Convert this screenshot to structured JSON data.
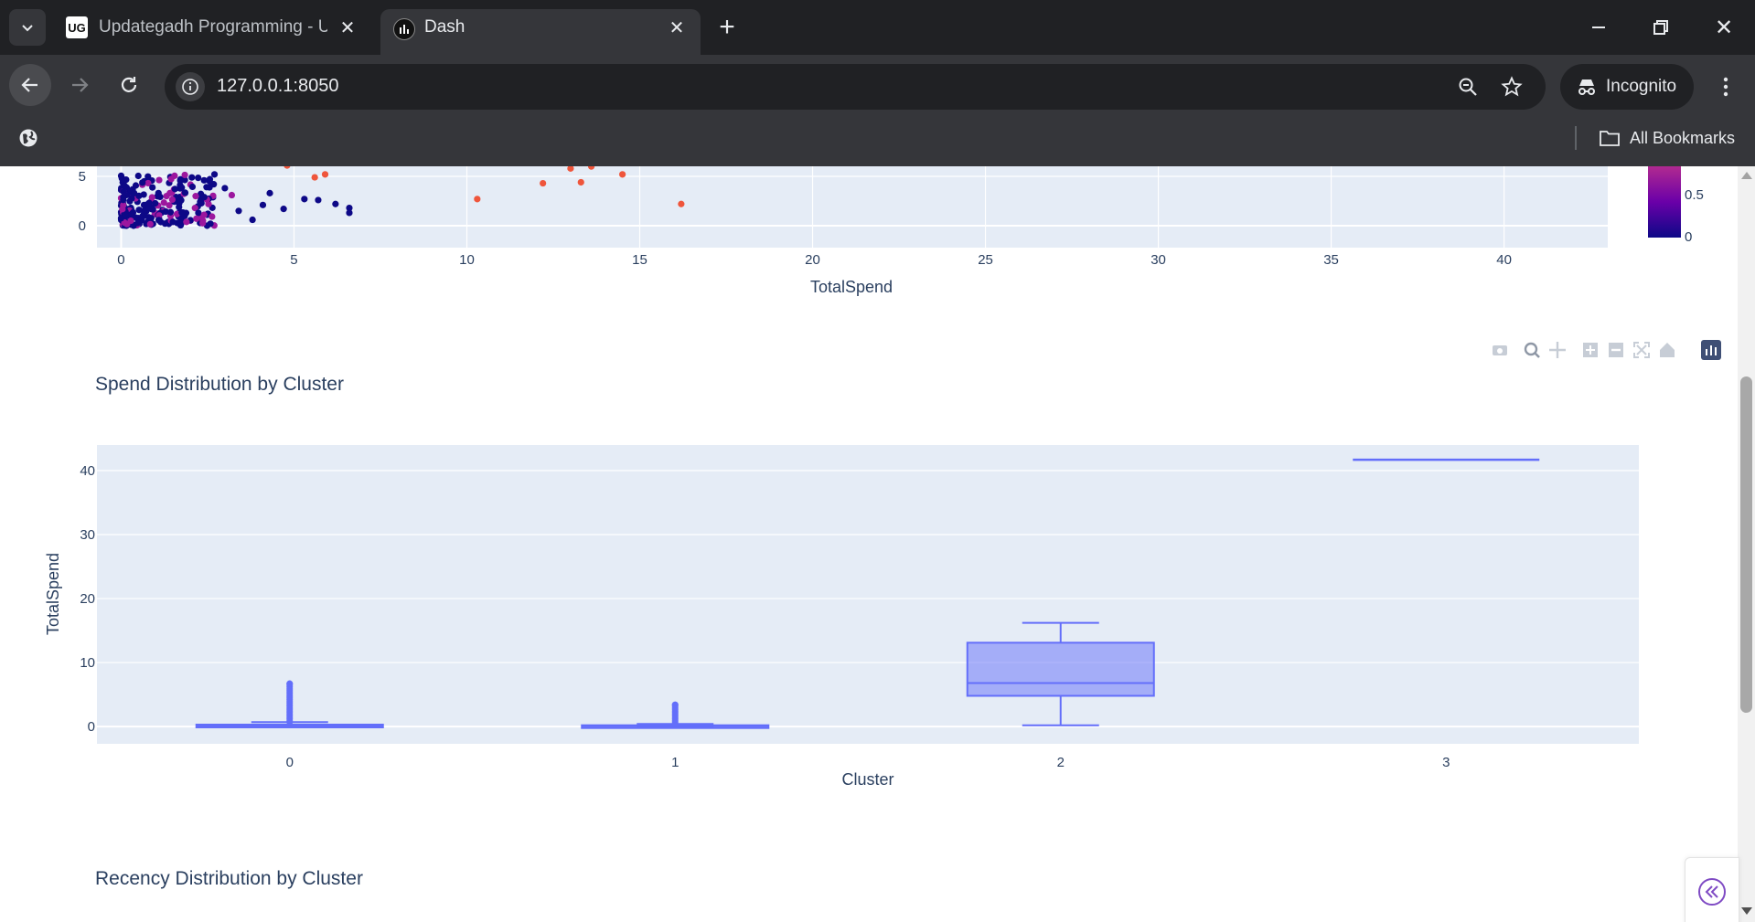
{
  "browser": {
    "tabs": [
      {
        "title": "Updategadh Programming - Up",
        "favicon": "UG"
      },
      {
        "title": "Dash",
        "favicon": "dash-icon"
      }
    ],
    "url": "127.0.0.1:8050",
    "incognito_label": "Incognito",
    "bookmarks_label": "All Bookmarks"
  },
  "scatter_chart": {
    "xlabel": "TotalSpend",
    "x_ticks": [
      "0",
      "5",
      "10",
      "15",
      "20",
      "25",
      "30",
      "35",
      "40"
    ],
    "y_ticks": [
      "0",
      "5"
    ],
    "colorbar_ticks": [
      "0.5",
      "0"
    ]
  },
  "box_chart": {
    "title": "Spend Distribution by Cluster",
    "xlabel": "Cluster",
    "ylabel": "TotalSpend",
    "x_ticks": [
      "0",
      "1",
      "2",
      "3"
    ],
    "y_ticks": [
      "0",
      "10",
      "20",
      "30",
      "40"
    ]
  },
  "next_chart": {
    "title": "Recency Distribution by Cluster"
  },
  "chart_data": [
    {
      "type": "scatter",
      "xlabel": "TotalSpend",
      "xlim": [
        -0.7,
        43
      ],
      "x_ticks": [
        0,
        5,
        10,
        15,
        20,
        25,
        30,
        35,
        40
      ],
      "y_ticks": [
        0,
        5
      ],
      "colors": {
        "cluster_low": "#0d0887",
        "cluster_mid": "#9c179e",
        "cluster_high": "#ef553b"
      },
      "outlier_points": [
        [
          10.3,
          2.7
        ],
        [
          12.2,
          4.3
        ],
        [
          13.0,
          5.8
        ],
        [
          13.3,
          4.4
        ],
        [
          13.6,
          6.0
        ],
        [
          14.5,
          5.2
        ],
        [
          16.2,
          2.2
        ],
        [
          4.8,
          6.1
        ],
        [
          5.6,
          4.9
        ],
        [
          5.9,
          5.2
        ]
      ],
      "mid_points": [
        [
          3.2,
          3.1
        ],
        [
          2.4,
          1.1
        ]
      ],
      "low_points": [
        [
          3.0,
          3.8
        ],
        [
          3.4,
          1.5
        ],
        [
          3.8,
          0.6
        ],
        [
          4.1,
          2.1
        ],
        [
          4.3,
          3.3
        ],
        [
          4.7,
          1.7
        ],
        [
          5.3,
          2.7
        ],
        [
          5.7,
          2.6
        ],
        [
          6.2,
          2.2
        ],
        [
          6.6,
          1.8
        ],
        [
          6.6,
          1.3
        ],
        [
          2.7,
          5.2
        ],
        [
          2.4,
          4.6
        ]
      ]
    },
    {
      "type": "box",
      "title": "Spend Distribution by Cluster",
      "xlabel": "Cluster",
      "ylabel": "TotalSpend",
      "categories": [
        "0",
        "1",
        "2",
        "3"
      ],
      "ylim": [
        -2.7,
        44
      ],
      "color": "#636efa",
      "boxes": [
        {
          "cluster": "0",
          "min": 0,
          "q1": 0,
          "median": 0.1,
          "q3": 0.3,
          "max": 0.7,
          "outlier_max": 6.7
        },
        {
          "cluster": "1",
          "min": 0,
          "q1": 0,
          "median": 0.05,
          "q3": 0.2,
          "max": 0.4,
          "outlier_max": 3.4
        },
        {
          "cluster": "2",
          "min": 0.2,
          "q1": 4.8,
          "median": 6.8,
          "q3": 13.1,
          "max": 16.2
        },
        {
          "cluster": "3",
          "min": 41.7,
          "q1": 41.7,
          "median": 41.7,
          "q3": 41.7,
          "max": 41.7
        }
      ]
    }
  ]
}
